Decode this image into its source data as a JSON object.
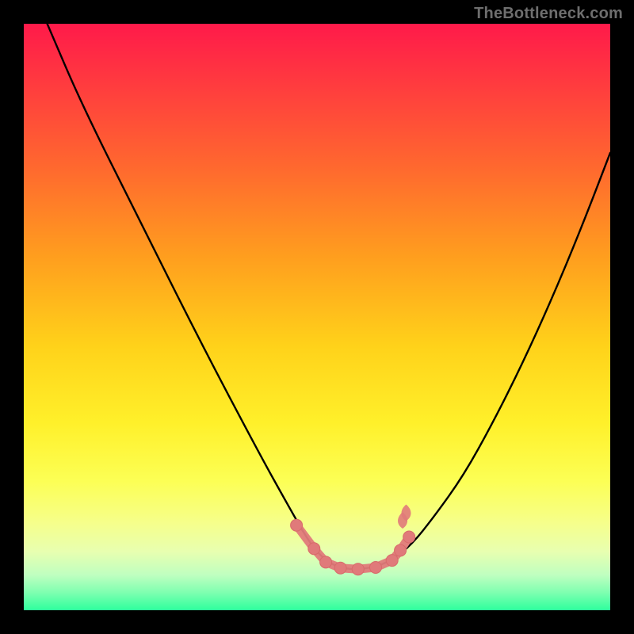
{
  "watermark": "TheBottleneck.com",
  "colors": {
    "marker_fill": "#e07a7a",
    "marker_stroke": "#d86a6a",
    "curve": "#000000"
  },
  "chart_data": {
    "type": "line",
    "title": "",
    "xlabel": "",
    "ylabel": "",
    "xlim": [
      0,
      100
    ],
    "ylim": [
      0,
      100
    ],
    "grid": false,
    "legend": null,
    "series": [
      {
        "name": "curve",
        "x": [
          4,
          10,
          20,
          30,
          40,
          45,
          49,
          52,
          55,
          58,
          62,
          66,
          70,
          75,
          80,
          85,
          90,
          95,
          100
        ],
        "y": [
          100,
          86,
          66,
          46,
          27,
          18,
          11,
          8,
          7,
          7,
          8,
          11,
          16,
          23,
          32,
          42,
          53,
          65,
          78
        ]
      }
    ],
    "markers": [
      {
        "x": 46.5,
        "y": 14.5,
        "kind": "dot"
      },
      {
        "x": 49.5,
        "y": 10.5,
        "kind": "dot"
      },
      {
        "x": 51.5,
        "y": 8.2,
        "kind": "dot"
      },
      {
        "x": 54.0,
        "y": 7.2,
        "kind": "dot"
      },
      {
        "x": 57.0,
        "y": 7.0,
        "kind": "dot"
      },
      {
        "x": 60.0,
        "y": 7.3,
        "kind": "dot"
      },
      {
        "x": 62.8,
        "y": 8.5,
        "kind": "dot"
      },
      {
        "x": 64.2,
        "y": 10.2,
        "kind": "dot"
      },
      {
        "x": 65.7,
        "y": 12.5,
        "kind": "dot"
      },
      {
        "x": 64.6,
        "y": 15.0,
        "kind": "flame"
      },
      {
        "x": 65.2,
        "y": 16.3,
        "kind": "flame"
      }
    ],
    "gradient_stops": [
      {
        "pct": 0,
        "color": "#ff1a4a"
      },
      {
        "pct": 25,
        "color": "#ff6a2e"
      },
      {
        "pct": 55,
        "color": "#ffd21a"
      },
      {
        "pct": 85,
        "color": "#f6ff8a"
      },
      {
        "pct": 100,
        "color": "#2eff9d"
      }
    ]
  }
}
